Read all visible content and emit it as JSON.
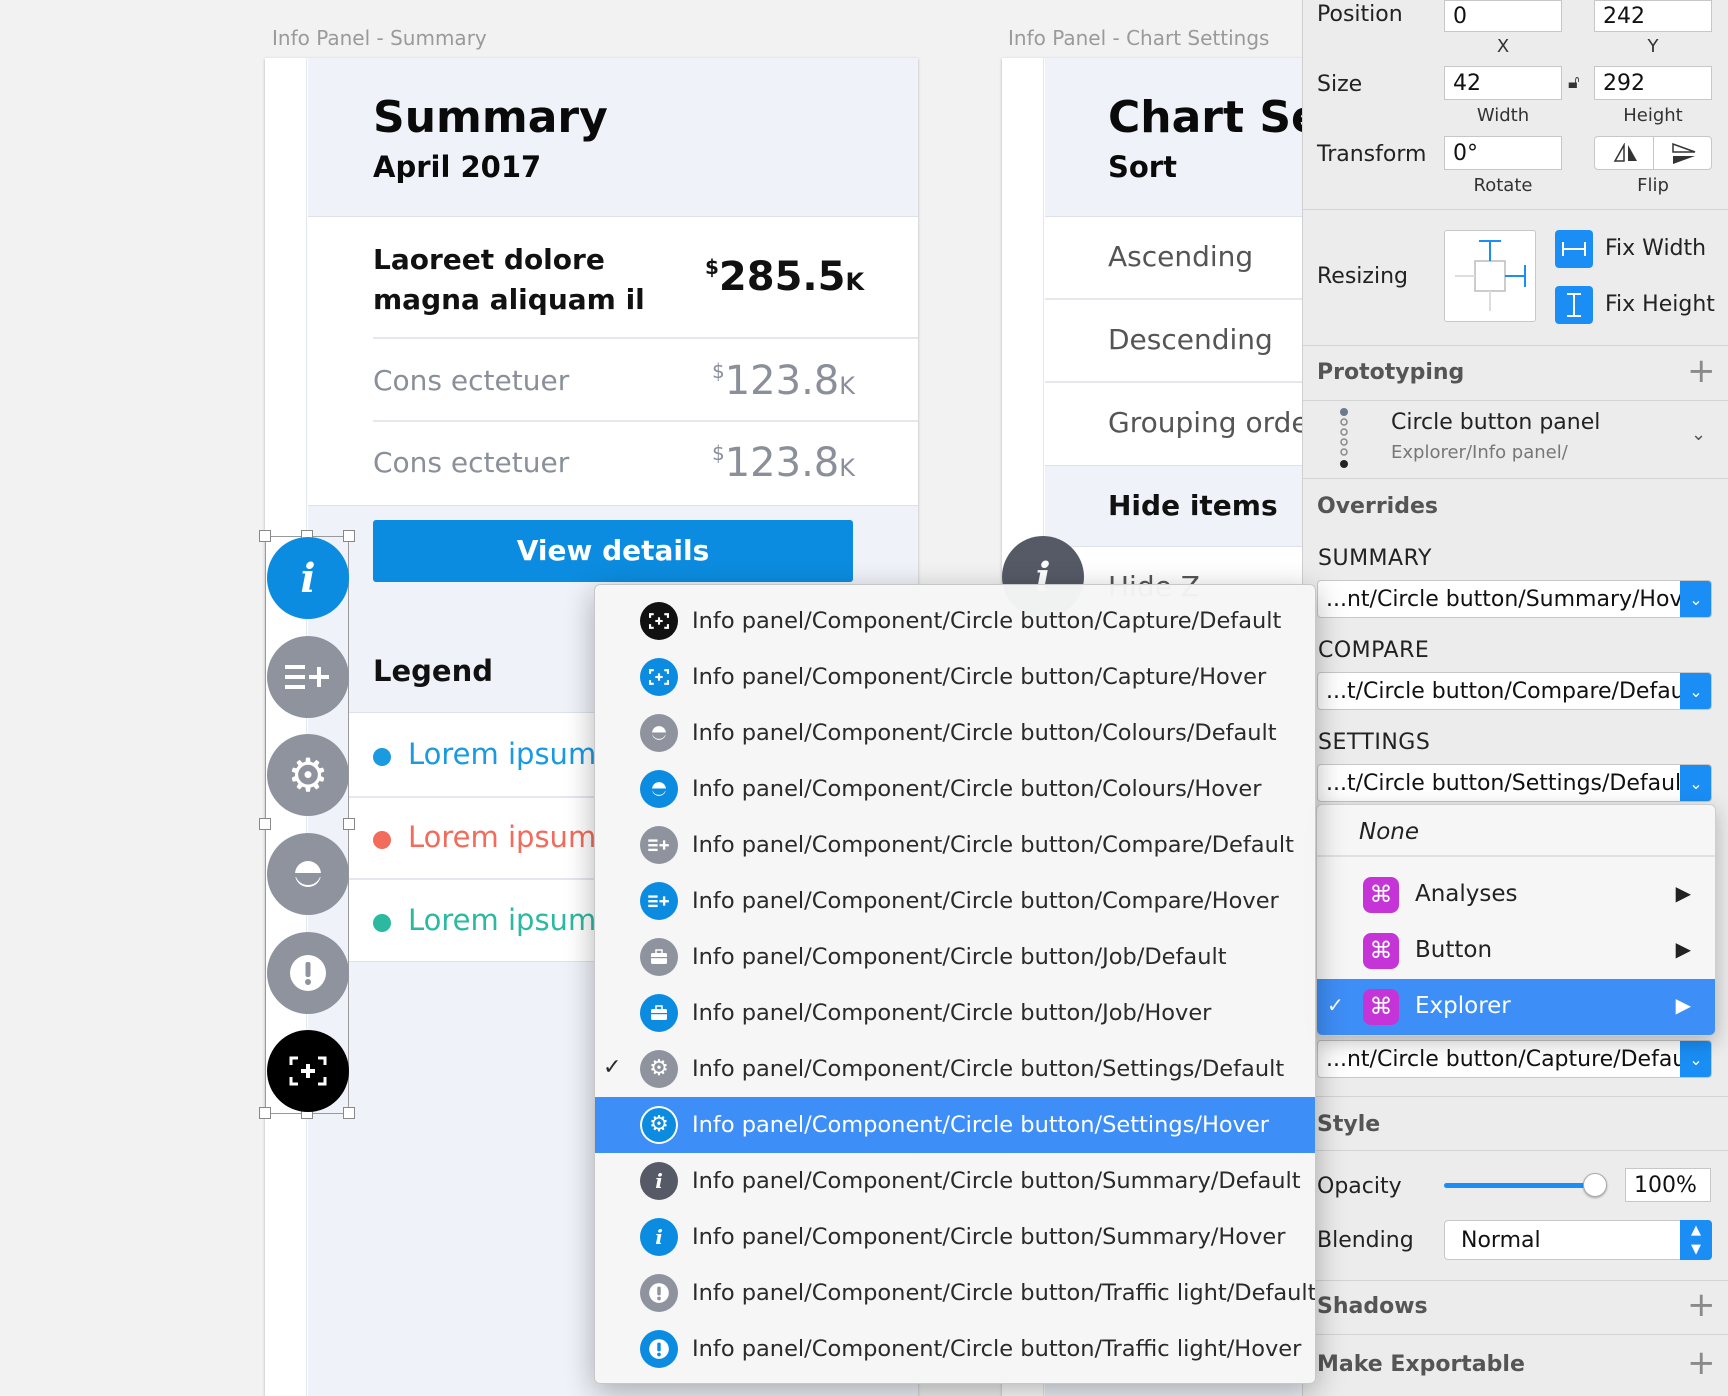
{
  "artboards": [
    {
      "label": "Info Panel - Summary"
    },
    {
      "label": "Info Panel - Chart Settings"
    }
  ],
  "summary": {
    "title": "Summary",
    "subtitle": "April 2017",
    "main_label": "Laoreet dolore magna aliquam il",
    "main_line1": "Laoreet dolore",
    "main_line2": "magna aliquam il",
    "main_value_prefix": "$",
    "main_value": "285.5",
    "main_value_suffix": "K",
    "rows": [
      {
        "label": "Cons ectetuer",
        "prefix": "$",
        "value": "123.8",
        "suffix": "K"
      },
      {
        "label": "Cons ectetuer",
        "prefix": "$",
        "value": "123.8",
        "suffix": "K"
      }
    ],
    "button": "View details",
    "legend_title": "Legend",
    "legend": [
      {
        "label": "Lorem ipsum",
        "color": "#1a9ae0"
      },
      {
        "label": "Lorem ipsum",
        "color": "#f26b5b"
      },
      {
        "label": "Lorem ipsum",
        "color": "#2bb9a0"
      }
    ]
  },
  "chart_settings": {
    "title": "Chart Sett",
    "subtitle": "Sort",
    "options": [
      "Ascending",
      "Descending",
      "Grouping orde"
    ],
    "hide_items": "Hide items",
    "partial": "Hide Z"
  },
  "inspector": {
    "position_label": "Position",
    "x_value": "0",
    "y_value": "242",
    "x_label": "X",
    "y_label": "Y",
    "size_label": "Size",
    "width_value": "42",
    "height_value": "292",
    "width_label": "Width",
    "height_label": "Height",
    "transform_label": "Transform",
    "rotate_value": "0°",
    "rotate_label": "Rotate",
    "flip_label": "Flip",
    "resizing_label": "Resizing",
    "fix_width": "Fix Width",
    "fix_height": "Fix Height",
    "prototyping": "Prototyping",
    "symbol_name": "Circle button panel",
    "symbol_path": "Explorer/Info panel/",
    "overrides": "Overrides",
    "override_items": [
      {
        "label": "SUMMARY",
        "value": "...nt/Circle button/Summary/Hover"
      },
      {
        "label": "COMPARE",
        "value": "...t/Circle button/Compare/Default"
      },
      {
        "label": "SETTINGS",
        "value": "...t/Circle button/Settings/Default"
      }
    ],
    "capture_value": "...nt/Circle button/Capture/Default",
    "style": "Style",
    "opacity_label": "Opacity",
    "opacity_value": "100%",
    "opacity_fraction": 1.0,
    "blending_label": "Blending",
    "blending_value": "Normal",
    "shadows": "Shadows",
    "exportable": "Make Exportable"
  },
  "submenu": {
    "none": "None",
    "items": [
      {
        "label": "Analyses",
        "icon": "symbol-icon"
      },
      {
        "label": "Button",
        "icon": "symbol-icon"
      },
      {
        "label": "Explorer",
        "icon": "symbol-icon",
        "checked": true
      }
    ]
  },
  "menu": {
    "items": [
      {
        "label": "Info panel/Component/Circle button/Capture/Default",
        "icon": "capture-icon",
        "color": "#111111"
      },
      {
        "label": "Info panel/Component/Circle button/Capture/Hover",
        "icon": "capture-icon",
        "color": "#0c8ce0"
      },
      {
        "label": "Info panel/Component/Circle button/Colours/Default",
        "icon": "colours-icon",
        "color": "#8e939e"
      },
      {
        "label": "Info panel/Component/Circle button/Colours/Hover",
        "icon": "colours-icon",
        "color": "#0c8ce0"
      },
      {
        "label": "Info panel/Component/Circle button/Compare/Default",
        "icon": "compare-icon",
        "color": "#8e939e"
      },
      {
        "label": "Info panel/Component/Circle button/Compare/Hover",
        "icon": "compare-icon",
        "color": "#0c8ce0"
      },
      {
        "label": "Info panel/Component/Circle button/Job/Default",
        "icon": "briefcase-icon",
        "color": "#8e939e"
      },
      {
        "label": "Info panel/Component/Circle button/Job/Hover",
        "icon": "briefcase-icon",
        "color": "#0c8ce0"
      },
      {
        "label": "Info panel/Component/Circle button/Settings/Default",
        "icon": "gear-icon",
        "color": "#8e939e",
        "checked": true
      },
      {
        "label": "Info panel/Component/Circle button/Settings/Hover",
        "icon": "gear-icon",
        "color": "#0c8ce0",
        "highlighted": true
      },
      {
        "label": "Info panel/Component/Circle button/Summary/Default",
        "icon": "info-icon",
        "color": "#555a66"
      },
      {
        "label": "Info panel/Component/Circle button/Summary/Hover",
        "icon": "info-icon",
        "color": "#0c8ce0"
      },
      {
        "label": "Info panel/Component/Circle button/Traffic light/Default",
        "icon": "alert-icon",
        "color": "#8e939e"
      },
      {
        "label": "Info panel/Component/Circle button/Traffic light/Hover",
        "icon": "alert-icon",
        "color": "#0c8ce0"
      }
    ]
  },
  "colors": {
    "accent": "#0c8ce0",
    "selection": "#3e8ef7",
    "symbol": "#c534d6"
  }
}
